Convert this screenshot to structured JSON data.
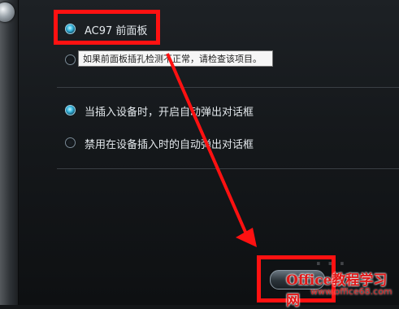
{
  "options": {
    "ac97_label": "AC97 前面板",
    "tooltip_text": "如果前面板插孔检测不正常，请检查该项目。",
    "auto_popup_label": "当插入设备时，开启自动弹出对话框",
    "disable_popup_label": "禁用在设备插入时的自动弹出对话框"
  },
  "watermark": {
    "brand": "Office教程学习网",
    "url": "www.office68.com"
  },
  "colors": {
    "annotation": "#ff1111",
    "radio_selected": "#39b8e0",
    "background": "#15181b"
  }
}
